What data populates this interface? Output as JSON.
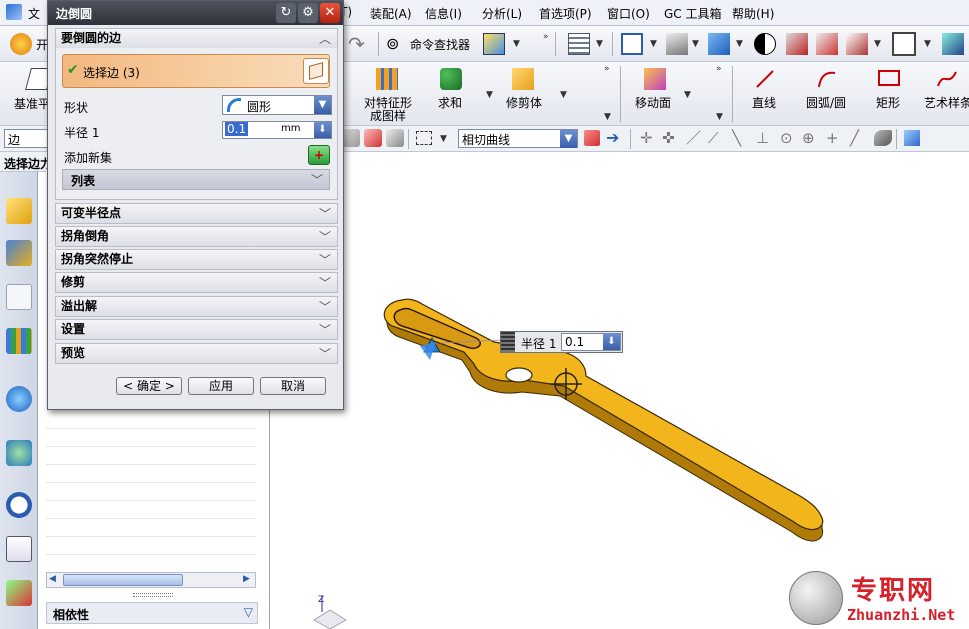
{
  "menubar": {
    "items": [
      "文",
      "T)",
      "装配(A)",
      "信息(I)",
      "分析(L)",
      "首选项(P)",
      "窗口(O)",
      "GC 工具箱",
      "帮助(H)"
    ]
  },
  "toolbar1": {
    "start_label": "开",
    "command_finder": "命令查找器"
  },
  "toolbar2": {
    "datum_label": "基准平",
    "pattern_label_1": "对特征形",
    "pattern_label_2": "成图样",
    "unite_label": "求和",
    "trim_body_label": "修剪体",
    "move_face_label": "移动面",
    "line_label": "直线",
    "arc_label": "圆弧/圆",
    "rect_label": "矩形",
    "studio_spline_label": "艺术样条"
  },
  "toolbar3": {
    "filter_value": "边",
    "curve_rule_value": "相切曲线"
  },
  "left": {
    "selection_bar_label": "选择边力",
    "dependency_label": "相依性"
  },
  "dialog": {
    "title": "边倒圆",
    "group_edges_title": "要倒圆的边",
    "select_edge_label": "选择边 (3)",
    "shape_label": "形状",
    "shape_value": "圆形",
    "radius_label": "半径 1",
    "radius_value": "0.1",
    "radius_unit": "mm",
    "add_new_set_label": "添加新集",
    "list_label": "列表",
    "sections": [
      "可变半径点",
      "拐角倒角",
      "拐角突然停止",
      "修剪",
      "溢出解",
      "设置",
      "预览"
    ],
    "ok_label": "< 确定 >",
    "apply_label": "应用",
    "cancel_label": "取消"
  },
  "viewport": {
    "radius_popup_label": "半径 1",
    "radius_popup_value": "0.1"
  },
  "watermark": {
    "cn_text": "专职网",
    "url_text": "Zhuanzhi.Net"
  },
  "colors": {
    "part_fill": "#f2b61c",
    "part_edge": "#3a2a05",
    "accent_blue": "#3a5da8",
    "watermark_red": "#d8202a"
  }
}
